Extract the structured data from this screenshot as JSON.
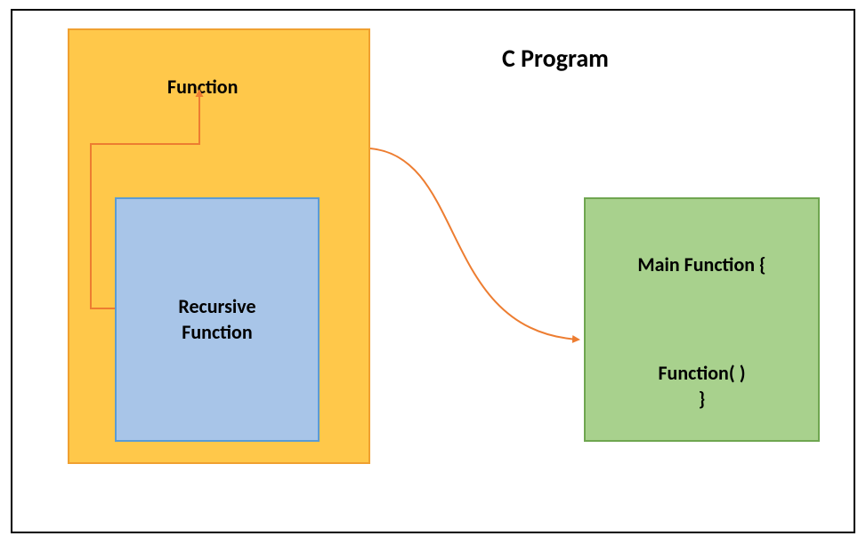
{
  "diagram": {
    "title": "C Program",
    "outer_box": {
      "label": "Function"
    },
    "inner_box": {
      "label_line1": "Recursive",
      "label_line2": "Function"
    },
    "right_box": {
      "top_text": "Main Function {",
      "call_line1": "Function( )",
      "call_line2": "}"
    }
  }
}
